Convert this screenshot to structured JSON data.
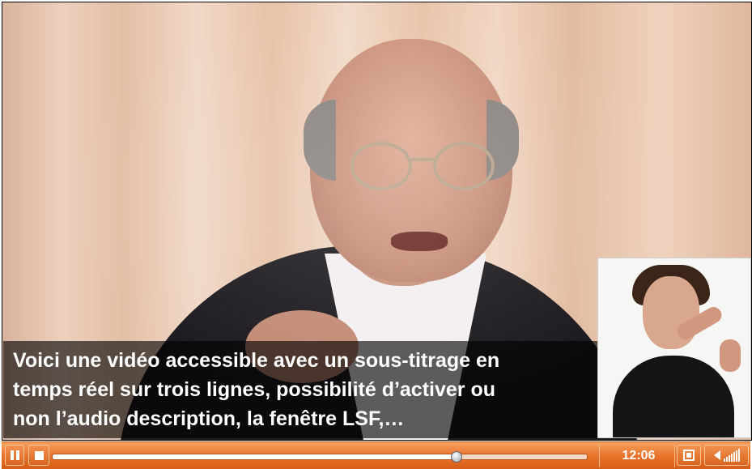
{
  "caption": {
    "lines": [
      "Voici une vidéo accessible avec un sous-titrage en",
      "temps réel sur trois lignes, possibilité d’activer ou",
      "non l’audio description, la fenêtre LSF,…"
    ]
  },
  "controls": {
    "play_state": "pause",
    "time": "12:06",
    "progress_fraction": 0.755
  },
  "colors": {
    "bar_accent": "#e8742b"
  },
  "icons": [
    "pause-icon",
    "stop-icon",
    "fullscreen-icon",
    "volume-icon"
  ]
}
